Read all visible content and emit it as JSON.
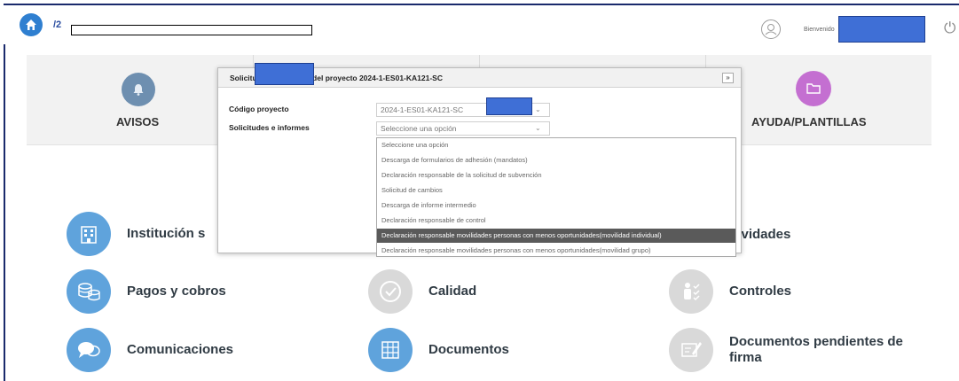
{
  "header": {
    "breadcrumb": "/2",
    "welcome": "Bienvenido"
  },
  "cards": {
    "avisos": "AVISOS",
    "ayuda": "AYUDA/PLANTILLAS"
  },
  "grid": {
    "institucion": "Institución s",
    "actividades": "ctividades",
    "pagos": "Pagos y cobros",
    "calidad": "Calidad",
    "controles": "Controles",
    "comunicaciones": "Comunicaciones",
    "documentos": "Documentos",
    "pendientes_line1": "Documentos pendientes de",
    "pendientes_line2": "firma"
  },
  "modal": {
    "title": "Solicitudes e informes del proyecto 2024-1-ES01-KA121-SC",
    "close": "»",
    "codigo_label": "Código proyecto",
    "codigo_value": "2024-1-ES01-KA121-SC",
    "solicitudes_label": "Solicitudes e informes",
    "solicitudes_value": "Seleccione una opción",
    "options": [
      "Seleccione una opción",
      "Descarga de formularios de adhesión (mandatos)",
      "Declaración responsable de la solicitud de subvención",
      "Solicitud de cambios",
      "Descarga de informe intermedio",
      "Declaración responsable de control",
      "Declaración responsable movilidades personas con menos oportunidades(movilidad individual)",
      "Declaración responsable movilidades personas con menos oportunidades(movilidad grupo)"
    ],
    "selected_index": 6
  },
  "colors": {
    "accent_blue": "#5fa3dc",
    "redaction": "#3f6fd6",
    "ayuda": "#c46fd1"
  }
}
